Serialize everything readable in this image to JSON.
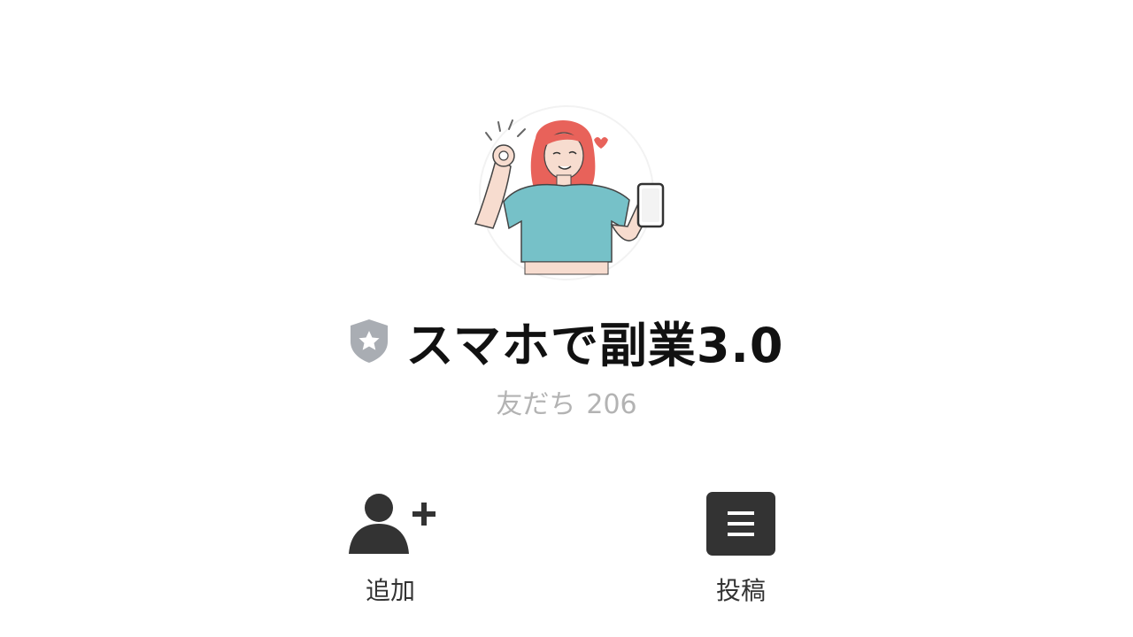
{
  "profile": {
    "name": "スマホで副業3.0",
    "friends_label": "友だち",
    "friends_count": "206"
  },
  "actions": {
    "add_label": "追加",
    "post_label": "投稿"
  },
  "icons": {
    "badge": "verified-shield-star-icon",
    "add": "add-friend-icon",
    "post": "menu-list-icon"
  },
  "colors": {
    "title": "#111111",
    "subtle": "#b3b3b3",
    "icon": "#333333",
    "badge": "#a9adb3"
  }
}
